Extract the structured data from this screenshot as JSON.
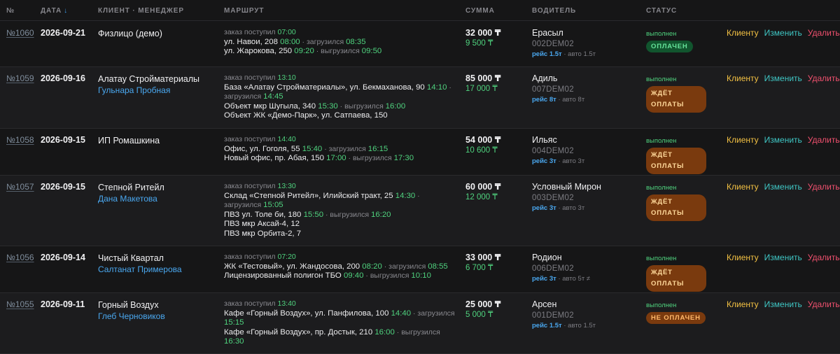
{
  "columns": {
    "num": "№",
    "date": "ДАТА",
    "client": "КЛИЕНТ · МЕНЕДЖЕР",
    "route": "МАРШРУТ",
    "sum": "СУММА",
    "driver": "ВОДИТЕЛЬ",
    "status": "СТАТУС",
    "sort_icon": "↓"
  },
  "actions": {
    "client": "Клиенту",
    "edit": "Изменить",
    "delete": "Удалить"
  },
  "colors": {
    "green": "#4fd27e",
    "blue": "#4aa8f0",
    "orange_badge": "#7a3a0e",
    "green_badge": "#11552e",
    "delete": "#f0506e",
    "client": "#f2c043",
    "edit": "#3fc6c4"
  },
  "rows": [
    {
      "num": "№1060",
      "date": "2026-09-21",
      "client": "Физлицо (демо)",
      "manager": "",
      "order_label": "заказ поступил",
      "order_time": "07:00",
      "stops": [
        {
          "addr": "ул. Навои, 208",
          "t1": "08:00",
          "sep": " · загрузился ",
          "t2": "08:35"
        },
        {
          "addr": "ул. Жарокова, 250",
          "t1": "09:20",
          "sep": " · выгрузился ",
          "t2": "09:50"
        }
      ],
      "total": "32 000 ₸",
      "pay": "9 500 ₸",
      "driver": "Ерасыл",
      "plate": "002DEM02",
      "trip": "рейс 1.5т",
      "auto": "· авто 1.5т",
      "status": "выполнен",
      "badge": "ОПЛАЧЕН",
      "badge_type": "paid"
    },
    {
      "num": "№1059",
      "date": "2026-09-16",
      "client": "Алатау Стройматериалы",
      "manager": "Гульнара Пробная",
      "order_label": "заказ поступил",
      "order_time": "13:10",
      "stops": [
        {
          "addr": "База «Алатау Стройматериалы», ул. Бекмаханова, 90",
          "t1": "14:10",
          "sep": " · загрузился ",
          "t2": "14:45"
        },
        {
          "addr": "Объект мкр Шугыла, 340",
          "t1": "15:30",
          "sep": " · выгрузился ",
          "t2": "16:00"
        },
        {
          "addr": "Объект ЖК «Демо-Парк», ул. Сатпаева, 150",
          "t1": "",
          "sep": "",
          "t2": ""
        }
      ],
      "total": "85 000 ₸",
      "pay": "17 000 ₸",
      "driver": "Адиль",
      "plate": "007DEM02",
      "trip": "рейс 8т",
      "auto": "· авто 8т",
      "status": "выполнен",
      "badge": "ЖДЁТ ОПЛАТЫ",
      "badge_type": "wait"
    },
    {
      "num": "№1058",
      "date": "2026-09-15",
      "client": "ИП Ромашкина",
      "manager": "",
      "order_label": "заказ поступил",
      "order_time": "14:40",
      "stops": [
        {
          "addr": "Офис, ул. Гоголя, 55",
          "t1": "15:40",
          "sep": " · загрузился ",
          "t2": "16:15"
        },
        {
          "addr": "Новый офис, пр. Абая, 150",
          "t1": "17:00",
          "sep": " · выгрузился ",
          "t2": "17:30"
        }
      ],
      "total": "54 000 ₸",
      "pay": "10 600 ₸",
      "driver": "Ильяс",
      "plate": "004DEM02",
      "trip": "рейс 3т",
      "auto": "· авто 3т",
      "status": "выполнен",
      "badge": "ЖДЁТ ОПЛАТЫ",
      "badge_type": "wait"
    },
    {
      "num": "№1057",
      "date": "2026-09-15",
      "client": "Степной Ритейл",
      "manager": "Дана Макетова",
      "order_label": "заказ поступил",
      "order_time": "13:30",
      "stops": [
        {
          "addr": "Склад «Степной Ритейл», Илийский тракт, 25",
          "t1": "14:30",
          "sep": " · загрузился ",
          "t2": "15:05"
        },
        {
          "addr": "ПВЗ ул. Толе би, 180",
          "t1": "15:50",
          "sep": " · выгрузился ",
          "t2": "16:20"
        },
        {
          "addr": "ПВЗ мкр Аксай-4, 12",
          "t1": "",
          "sep": "",
          "t2": ""
        },
        {
          "addr": "ПВЗ мкр Орбита-2, 7",
          "t1": "",
          "sep": "",
          "t2": ""
        }
      ],
      "total": "60 000 ₸",
      "pay": "12 000 ₸",
      "driver": "Условный Мирон",
      "plate": "003DEM02",
      "trip": "рейс 3т",
      "auto": "· авто 3т",
      "status": "выполнен",
      "badge": "ЖДЁТ ОПЛАТЫ",
      "badge_type": "wait"
    },
    {
      "num": "№1056",
      "date": "2026-09-14",
      "client": "Чистый Квартал",
      "manager": "Салтанат Примерова",
      "order_label": "заказ поступил",
      "order_time": "07:20",
      "stops": [
        {
          "addr": "ЖК «Тестовый», ул. Жандосова, 200",
          "t1": "08:20",
          "sep": " · загрузился ",
          "t2": "08:55"
        },
        {
          "addr": "Лицензированный полигон ТБО",
          "t1": "09:40",
          "sep": " · выгрузился ",
          "t2": "10:10"
        }
      ],
      "total": "33 000 ₸",
      "pay": "6 700 ₸",
      "driver": "Родион",
      "plate": "006DEM02",
      "trip": "рейс 3т",
      "auto": "· авто 5т ≠",
      "status": "выполнен",
      "badge": "ЖДЁТ ОПЛАТЫ",
      "badge_type": "wait"
    },
    {
      "num": "№1055",
      "date": "2026-09-11",
      "client": "Горный Воздух",
      "manager": "Глеб Черновиков",
      "order_label": "заказ поступил",
      "order_time": "13:40",
      "stops": [
        {
          "addr": "Кафе «Горный Воздух», ул. Панфилова, 100",
          "t1": "14:40",
          "sep": " · загрузился ",
          "t2": "15:15"
        },
        {
          "addr": "Кафе «Горный Воздух», пр. Достык, 210",
          "t1": "16:00",
          "sep": " · выгрузился ",
          "t2": "16:30"
        }
      ],
      "total": "25 000 ₸",
      "pay": "5 000 ₸",
      "driver": "Арсен",
      "plate": "001DEM02",
      "trip": "рейс 1.5т",
      "auto": "· авто 1.5т",
      "status": "выполнен",
      "badge": "НЕ ОПЛАЧЕН",
      "badge_type": "unpaid"
    }
  ]
}
